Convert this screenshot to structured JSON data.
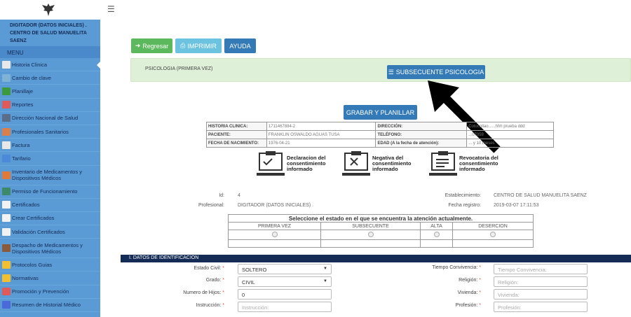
{
  "sidebar": {
    "user": "DIGITADOR (DATOS INICIALES) . CENTRO DE SALUD MANUELITA SAENZ",
    "menu_label": "MENU",
    "items": [
      {
        "label": "Historia Clinica",
        "color": "#e8e8e8"
      },
      {
        "label": "Cambio de clave",
        "color": "#7fb3d5"
      },
      {
        "label": "Planillaje",
        "color": "#3c9a3c"
      },
      {
        "label": "Reportes",
        "color": "#e05a5a"
      },
      {
        "label": "Dirección Nacional de Salud",
        "color": "#5a6e8a"
      },
      {
        "label": "Profesionales Sanitarios",
        "color": "#d9804a"
      },
      {
        "label": "Factura",
        "color": "#e8e8e8"
      },
      {
        "label": "Tarifario",
        "color": "#4a8ad9"
      },
      {
        "label": "Inventario de Medicamentos y Dispositivos Médicos",
        "color": "#e07a3a"
      },
      {
        "label": "Permiso de Funcionamiento",
        "color": "#3c8a6a"
      },
      {
        "label": "Certificados",
        "color": "#f2f2f2"
      },
      {
        "label": "Crear Certificados",
        "color": "#f2f2f2"
      },
      {
        "label": "Validación Certificados",
        "color": "#f2f2f2"
      },
      {
        "label": "Despacho de Medicamentos y Dispositivos Médicos",
        "color": "#8a5a3a"
      },
      {
        "label": "Protocolos Guias",
        "color": "#f0c030"
      },
      {
        "label": "Normativas",
        "color": "#f0c030"
      },
      {
        "label": "Promoción y Prevención",
        "color": "#e05a5a"
      },
      {
        "label": "Resumen de Historial Médico",
        "color": "#4a6ad9"
      }
    ]
  },
  "toolbar": {
    "back": "Regresar",
    "print": "IMPRIMIR",
    "help": "AYUDA"
  },
  "panel": {
    "title": "PSICOLOGIA (PRIMERA VEZ)",
    "subsequent_button": "SUBSECUENTE PSICOLOGIA"
  },
  "grabar_button": "GRABAR Y PLANILLAR",
  "patient": {
    "rows": [
      [
        "HISTORIA CLINICA:",
        "1711467884-2",
        "DIRECCIÓN:",
        "Cotocollao......hhh prueba ddd"
      ],
      [
        "PACIENTE:",
        "FRANKLIN OSWALDO AGUAS TUSA",
        "TELÉFONO:",
        "...07059"
      ],
      [
        "FECHA DE NACIMIENTO:",
        "1976-04-21",
        "EDAD (A la fecha de atención):",
        "... y 10 meses"
      ]
    ]
  },
  "consents": [
    "Declaracion del consentimiento informado",
    "Negativa del consentimiento informado",
    "Revocatoria del consentimiento informado"
  ],
  "record": {
    "id_label": "Id:",
    "id_value": "4",
    "prof_label": "Profesional:",
    "prof_value": "DIGITADOR (DATOS INICIALES) .",
    "est_label": "Establecimiento:",
    "est_value": "CENTRO DE SALUD MANUELITA SAENZ",
    "fecha_label": "Fecha registro:",
    "fecha_value": "2019-03-07 17:11:53"
  },
  "estado": {
    "title": "Seleccione el estado en el que se encuentra la atención actualmente.",
    "columns": [
      "PRIMERA VEZ",
      "SUBSECUENTE",
      "ALTA",
      "DESERCION"
    ]
  },
  "section_title": "I. DATOS DE IDENTIFICACION",
  "form": {
    "estado_civil": {
      "label": "Estado Civil:",
      "value": "SOLTERO"
    },
    "grado": {
      "label": "Grado:",
      "value": "CIVIL"
    },
    "hijos": {
      "label": "Numero de Hijos:",
      "value": "0"
    },
    "instruccion": {
      "label": "Instrucción:",
      "placeholder": "Instrucción:"
    },
    "tiempo": {
      "label": "Tiempo Convivencia:",
      "placeholder": "Tiempo Convivencia:"
    },
    "religion": {
      "label": "Religión:",
      "placeholder": "Religión:"
    },
    "vivienda": {
      "label": "Vivienda:",
      "placeholder": "Vivienda:"
    },
    "profesion": {
      "label": "Profesión:",
      "placeholder": "Profesión:"
    }
  }
}
